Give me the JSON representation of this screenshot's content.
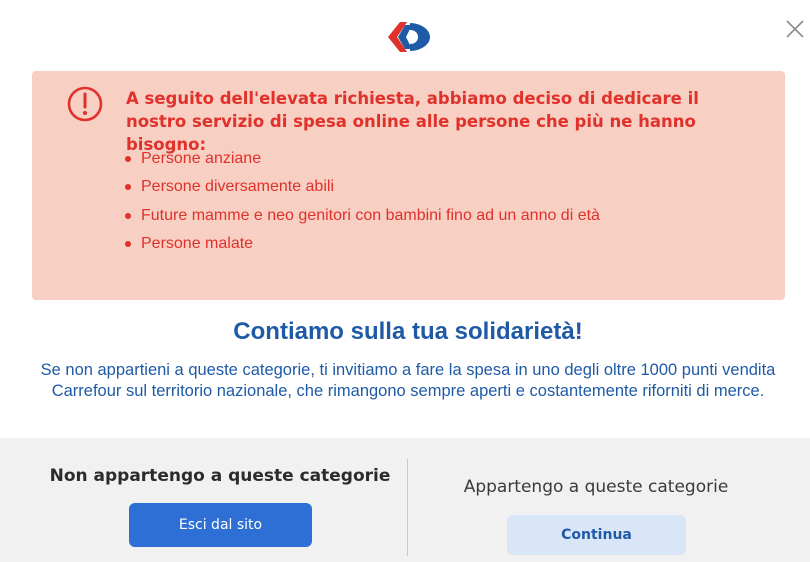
{
  "brand": {
    "logo": "carrefour-logo",
    "colors": {
      "red": "#e0312b",
      "blue": "#1f5aa6"
    }
  },
  "dialog": {
    "close_icon": "close-icon"
  },
  "alert": {
    "icon": "exclamation-circle-icon",
    "title": "A seguito dell'elevata richiesta, abbiamo deciso di dedicare il nostro servizio di spesa online alle persone che più ne hanno bisogno:",
    "items": [
      "Persone anziane",
      "Persone diversamente abili",
      "Future mamme e neo genitori con bambini fino ad un anno di età",
      "Persone malate"
    ],
    "background": "#f8cfc3"
  },
  "main": {
    "headline": "Contiamo sulla tua solidarietà!",
    "paragraph": "Se non appartieni a queste categorie, ti invitiamo a fare la spesa in uno degli oltre 1000 punti vendita Carrefour sul territorio nazionale, che rimangono sempre aperti e costantemente riforniti di merce."
  },
  "footer": {
    "left": {
      "title": "Non appartengo a queste categorie",
      "button": "Esci dal sito"
    },
    "right": {
      "title": "Appartengo a queste categorie",
      "button": "Continua"
    }
  }
}
